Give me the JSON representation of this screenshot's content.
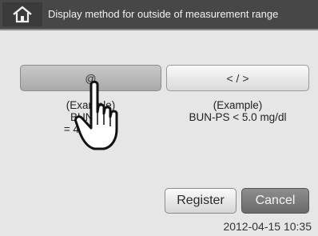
{
  "header": {
    "title": "Display method for outside of measurement range",
    "home_icon": "home-icon"
  },
  "options": [
    {
      "label": "@",
      "selected": true,
      "example_heading": "(Example)",
      "example_line1": "BUN-PS",
      "example_line2": "= 4.0 mg/dl"
    },
    {
      "label": "< / >",
      "selected": false,
      "example_heading": "(Example)",
      "example_line1": "BUN-PS < 5.0 mg/dl",
      "example_line2": ""
    }
  ],
  "actions": {
    "register_label": "Register",
    "cancel_label": "Cancel"
  },
  "status": {
    "datetime": "2012-04-15 10:35"
  },
  "overlay": {
    "pointer_icon": "hand-pointer-icon"
  }
}
